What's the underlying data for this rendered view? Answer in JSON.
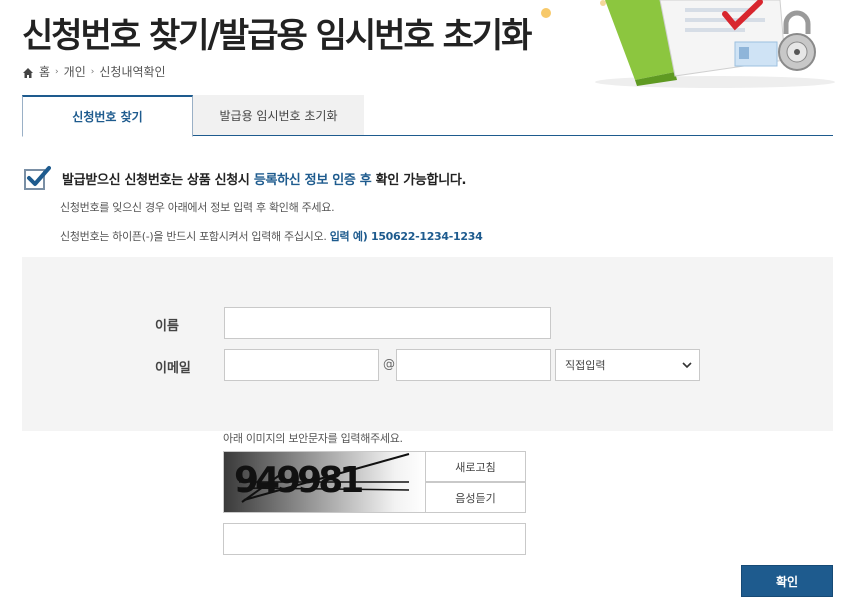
{
  "page": {
    "title": "신청번호 찾기/발급용 임시번호 초기화"
  },
  "breadcrumb": {
    "home": "홈",
    "level1": "개인",
    "level2": "신청내역확인"
  },
  "tabs": [
    {
      "label": "신청번호 찾기",
      "active": true
    },
    {
      "label": "발급용 임시번호 초기화",
      "active": false
    }
  ],
  "notice": {
    "part1": "발급받으신 신청번호는 상품 신청시 ",
    "highlight": "등록하신 정보 인증 후",
    "part2": " 확인 가능합니다.",
    "sub1": "신청번호를 잊으신 경우 아래에서 정보 입력 후 확인해 주세요.",
    "sub2_text": "신청번호는 하이픈(-)을 반드시 포함시켜서 입력해 주십시오. ",
    "sub2_example": "입력 예) 150622-1234-1234"
  },
  "form": {
    "name_label": "이름",
    "name_value": "",
    "email_label": "이메일",
    "email_local_value": "",
    "email_at": "@",
    "email_domain_value": "",
    "domain_select": "직접입력"
  },
  "captcha": {
    "hint": "아래 이미지의 보안문자를 입력해주세요.",
    "code": "949981",
    "refresh_label": "새로고침",
    "audio_label": "음성듣기",
    "input_value": ""
  },
  "actions": {
    "confirm_label": "확인"
  },
  "colors": {
    "accent": "#1e5b8e",
    "form_bg": "#f4f4f4"
  },
  "icons": {
    "home": "home-icon",
    "check": "checkbox-checked-icon",
    "chevron": "chevron-down-icon",
    "lock": "padlock-icon"
  }
}
